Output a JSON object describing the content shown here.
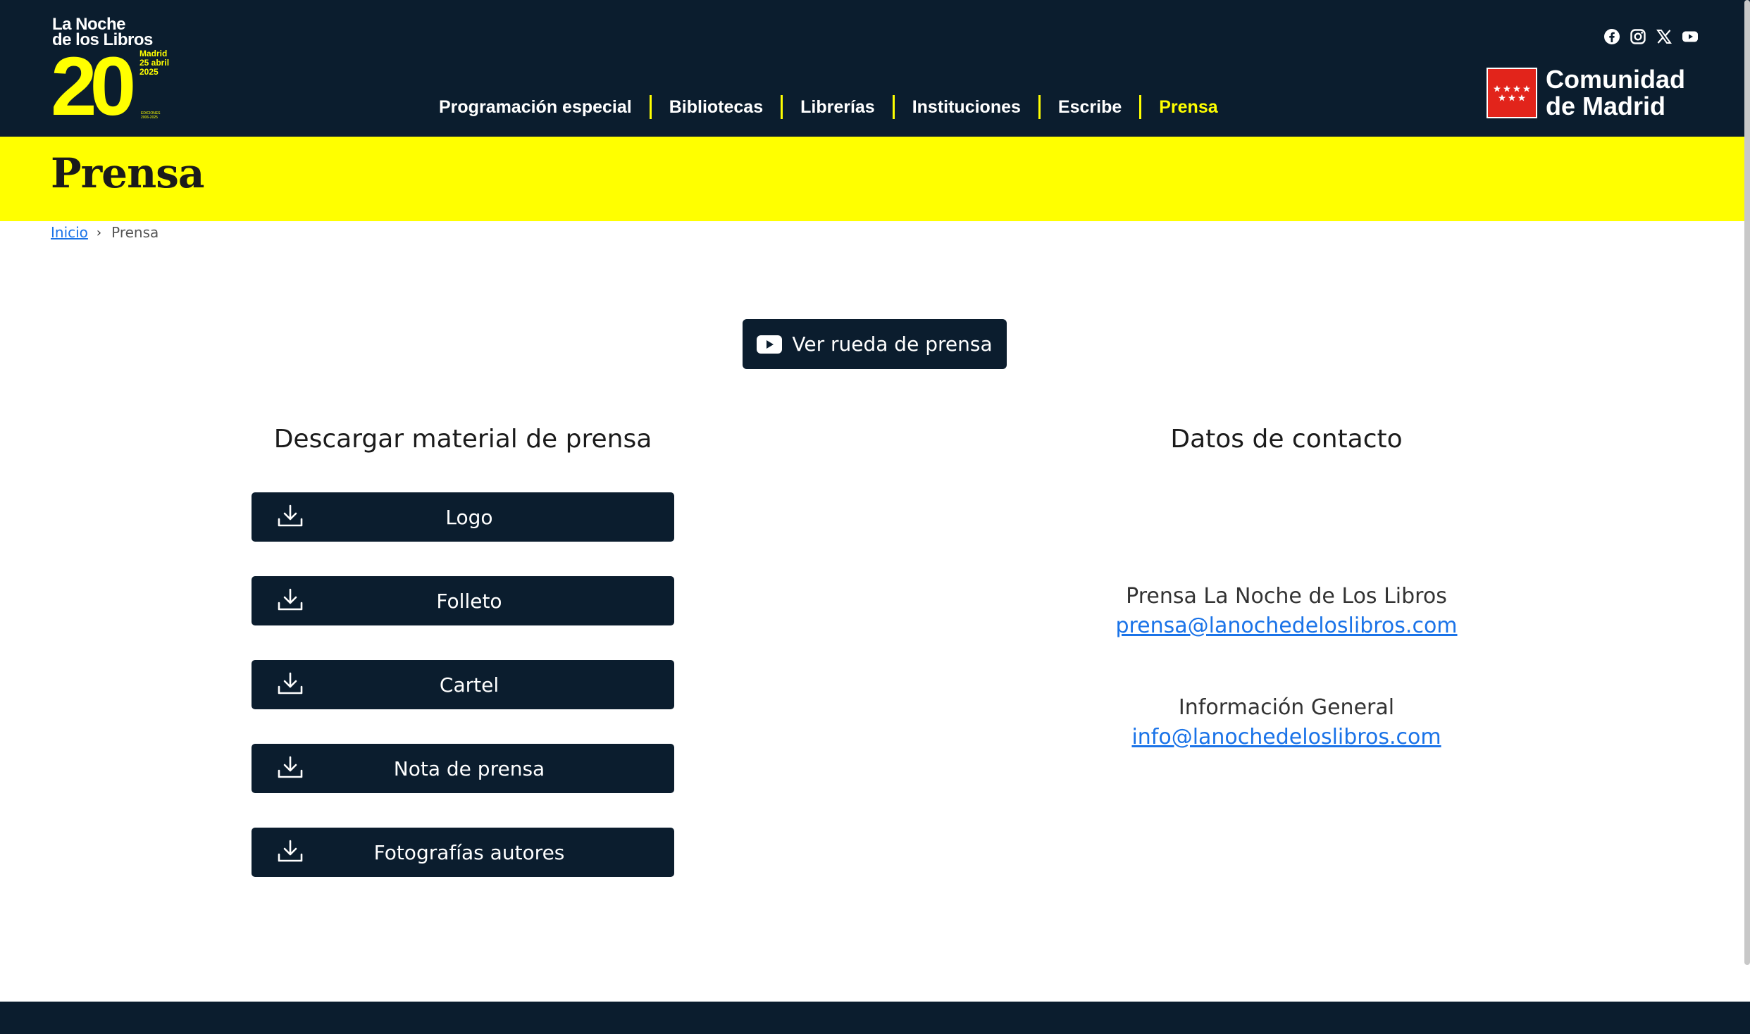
{
  "logo": {
    "title": "La Noche\nde los Libros",
    "number": "20",
    "place_date": "Madrid\n25 abril\n2025",
    "editions": "EDICIONES\n2006-2025"
  },
  "nav": {
    "items": [
      {
        "label": "Programación especial",
        "active": false
      },
      {
        "label": "Bibliotecas",
        "active": false
      },
      {
        "label": "Librerías",
        "active": false
      },
      {
        "label": "Instituciones",
        "active": false
      },
      {
        "label": "Escribe",
        "active": false
      },
      {
        "label": "Prensa",
        "active": true
      }
    ]
  },
  "social": [
    "facebook-icon",
    "instagram-icon",
    "x-icon",
    "youtube-icon"
  ],
  "sponsor": {
    "name": "Comunidad\nde Madrid"
  },
  "page": {
    "title": "Prensa"
  },
  "breadcrumb": {
    "home": "Inicio",
    "current": "Prensa"
  },
  "video_button": {
    "label": "Ver rueda de prensa",
    "icon": "youtube-icon"
  },
  "downloads": {
    "title": "Descargar material de prensa",
    "items": [
      "Logo",
      "Folleto",
      "Cartel",
      "Nota de prensa",
      "Fotografías autores"
    ]
  },
  "contact": {
    "title": "Datos de contacto",
    "entries": [
      {
        "name": "Prensa La Noche de Los Libros",
        "email": "prensa@lanochedeloslibros.com"
      },
      {
        "name": "Información General",
        "email": "info@lanochedeloslibros.com"
      }
    ]
  },
  "colors": {
    "navy": "#0b1d2e",
    "yellow": "#ffff00",
    "link": "#1a73e8",
    "flag_red": "#e2241b"
  }
}
